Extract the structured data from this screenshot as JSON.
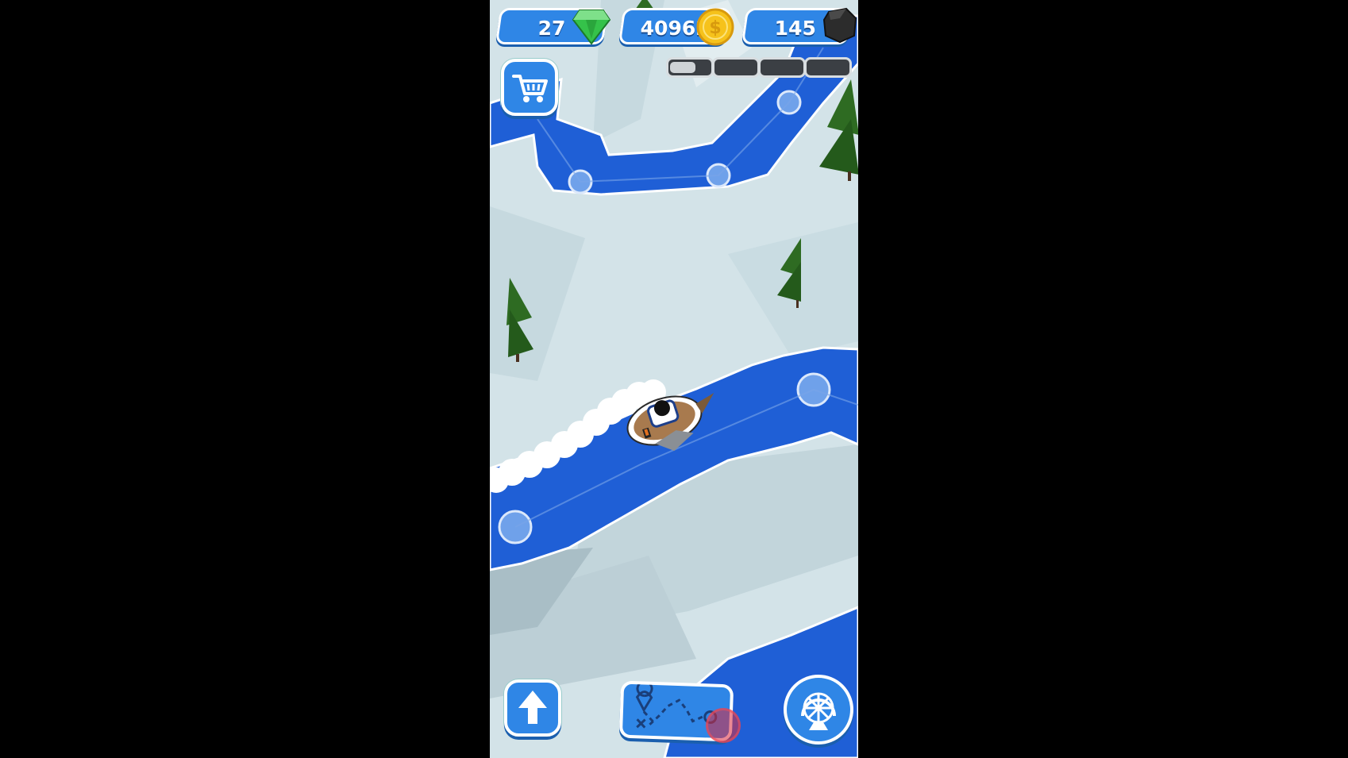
{
  "hud": {
    "gems": "27",
    "coins": "40962",
    "coal": "145"
  },
  "progress": {
    "segments_total": 4,
    "current_segment_fill": 0.6
  },
  "buttons": {
    "shop_icon": "cart-icon",
    "boost_icon": "arrow-up-icon",
    "map_icon": "route-map-icon",
    "wheel_icon": "wheel-icon"
  },
  "colors": {
    "river": "#1f5fd6",
    "snow": "#d3e3e8",
    "ui_blue": "#2f86e6",
    "gem": "#35c24a",
    "coin": "#f6c21b",
    "tree": "#1f4d1a"
  }
}
